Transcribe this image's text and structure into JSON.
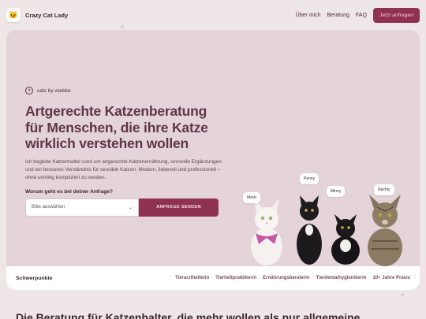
{
  "header": {
    "brand": "Crazy Cat Lady",
    "logo_glyph": "🐱",
    "nav": [
      "Über mich",
      "Beratung",
      "FAQ"
    ],
    "cta": "Jetzt anfragen"
  },
  "hero": {
    "eyebrow": "cats by wiebke",
    "title": "Artgerechte Katzenberatung für Menschen, die ihre Katze wirklich verstehen wollen",
    "description": "Ich begleite Katzenhalter rund um artgerechte Katzenernährung, sinnvolle Ergänzungen und ein besseres Verständnis für sensible Katzen. Modern, liebevoll und professionell – ohne unnötig kompliziert zu werden.",
    "form_label": "Worum geht es bei deiner Anfrage?",
    "select_placeholder": "Bitte auswählen",
    "submit": "ANFRAGE SENDEN",
    "cats": [
      "Metzi",
      "Penny",
      "Minny",
      "Nachty"
    ]
  },
  "strip": {
    "title": "Schwerpunkte",
    "tags": [
      "Tierarztheiferin",
      "Tierheilpraktikerin",
      "Ernährungsberaterin",
      "Tierdentalhygienikerin",
      "10+ Jahre Praxis"
    ]
  },
  "bottom_heading": "Die Beratung für Katzenhalter, die mehr wollen als nur allgemeine",
  "colors": {
    "accent": "#8f3250",
    "hero_bg": "#e5d3da",
    "page_bg": "#efe6e8"
  }
}
